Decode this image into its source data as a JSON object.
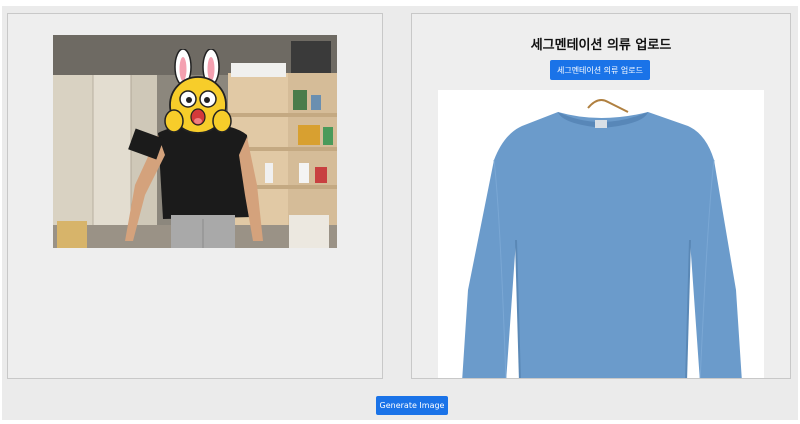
{
  "left_panel": {
    "webcam_image": "webcam-feed-person"
  },
  "right_panel": {
    "title": "세그멘테이션 의류 업로드",
    "upload_button_label": "세그멘테이션 의류 업로드",
    "garment_image": "blue-long-sleeve-shirt"
  },
  "footer": {
    "generate_button_label": "Generate Image"
  },
  "colors": {
    "primary": "#1a73e8",
    "panel_bg": "#eeeeee",
    "shirt": "#6b9bcb"
  }
}
